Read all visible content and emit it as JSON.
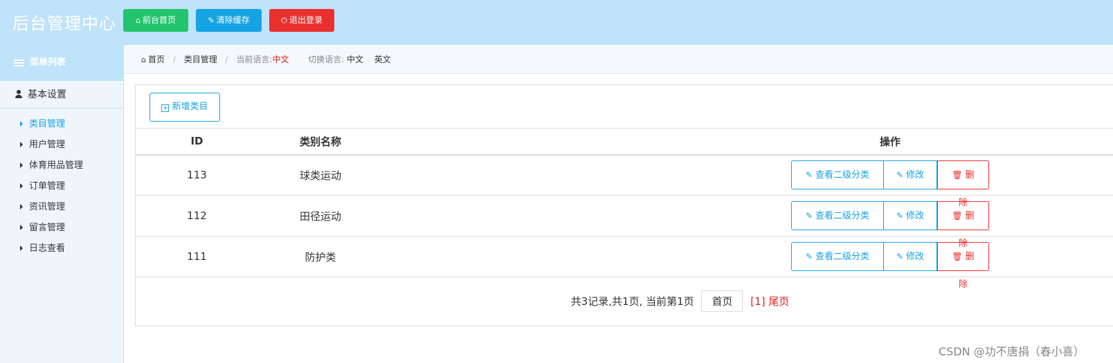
{
  "header": {
    "brand": "后台管理中心",
    "buttons": [
      {
        "label": "前台首页",
        "icon": "home-icon",
        "color": "#23c46d"
      },
      {
        "label": "清除缓存",
        "icon": "wrench-icon",
        "color": "#16a3e3"
      },
      {
        "label": "退出登录",
        "icon": "power-icon",
        "color": "#e9302f"
      }
    ]
  },
  "sidebar": {
    "menu_title": "菜单列表",
    "section": "基本设置",
    "items": [
      {
        "label": "类目管理",
        "active": true
      },
      {
        "label": "用户管理"
      },
      {
        "label": "体育用品管理"
      },
      {
        "label": "订单管理"
      },
      {
        "label": "资讯管理"
      },
      {
        "label": "留言管理"
      },
      {
        "label": "日志查看"
      }
    ]
  },
  "breadcrumb": {
    "home": "首页",
    "current": "类目管理",
    "lang_label": "当前语言:",
    "lang_value": "中文",
    "switch_label": "切换语言:",
    "switch_cn": "中文",
    "switch_en": "英文"
  },
  "toolbar": {
    "add_label": "新增类目"
  },
  "table": {
    "headers": [
      "ID",
      "类别名称",
      "操作"
    ],
    "rows": [
      {
        "id": "113",
        "name": "球类运动"
      },
      {
        "id": "112",
        "name": "田径运动"
      },
      {
        "id": "111",
        "name": "防护类"
      }
    ],
    "actions": {
      "view": "查看二级分类",
      "edit": "修改",
      "delete": "删除"
    }
  },
  "pager": {
    "summary": "共3记录,共1页, 当前第1页",
    "first": "首页",
    "current": "[1]",
    "last": "尾页"
  },
  "watermark": "CSDN @功不唐捐（春小喜）",
  "colors": {
    "accent": "#16a3e3",
    "danger": "#e9302f",
    "success": "#23c46d",
    "header_bg": "#bfe3f9"
  }
}
